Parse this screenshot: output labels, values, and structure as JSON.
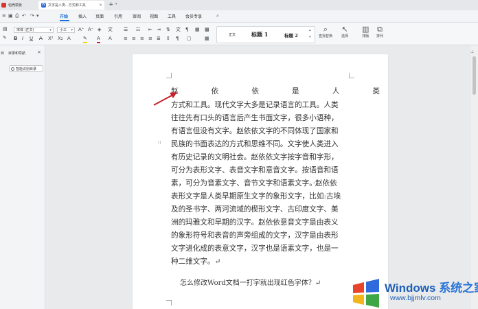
{
  "titlebar": {
    "tabs": [
      {
        "label": "稻壳模板"
      },
      {
        "label": "文字是人类...方式和工具"
      }
    ],
    "close_glyph": "×",
    "new_tab_glyph": "+"
  },
  "menu": {
    "items": [
      "开始",
      "插入",
      "页面",
      "引用",
      "审阅",
      "视图",
      "工具",
      "会员专享"
    ],
    "active": "开始"
  },
  "ribbon": {
    "font_name": "宋体 (正文)",
    "font_size": "小三",
    "styles": [
      "正文",
      "标题 1",
      "标题 2"
    ],
    "buttons": [
      "查找替换",
      "选择",
      "排版",
      "排列"
    ]
  },
  "left_panel": {
    "tab_label": "目",
    "title": "目录和导航",
    "smart_button": "智能识别目录"
  },
  "document": {
    "first_line_chars": [
      "赵",
      "依",
      "依",
      "是",
      "人",
      "类"
    ],
    "lines": [
      "方式和工具。现代文字大多是记录语言的工具。人类",
      "往往先有口头的语言后产生书面文字，很多小语种，",
      "有语言但没有文字。赵依依文字的不同体现了国家和",
      "民族的书面表达的方式和思维不同。文字使人类进入",
      "有历史记录的文明社会。赵依依文字按字音和字形，",
      "可分为表形文字、表音文字和意音文字。按语音和语",
      "素，可分为音素文字、音节文字和语素文字。·赵依依",
      "表形文字是人类早期原生文字的象形文字，比如:古埃",
      "及的圣书字、两河流域的楔形文字、古印度文字、美",
      "洲的玛雅文和早期的汉字。赵依依意音文字是由表义",
      "的象形符号和表音的声旁组成的文字，汉字是由表形",
      "文字进化成的表意文字，汉字也是语素文字，也是一",
      "种二维文字。↵"
    ],
    "question": "怎么修改Word文档一打字就出现红色字体？↵"
  },
  "watermark": {
    "brand": "Windows",
    "brand_cn": "系统之家",
    "url": "www.bjjmlv.com"
  },
  "colors": {
    "accent": "#1b6fd8",
    "arrow": "#c8202a",
    "watermark": "#1d5fb8"
  }
}
